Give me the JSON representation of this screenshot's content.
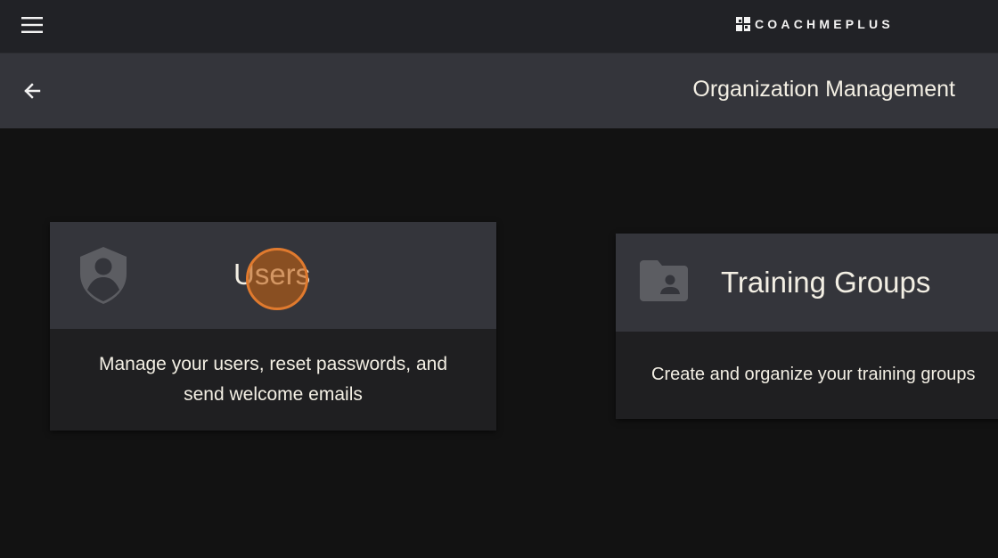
{
  "topbar": {
    "menu_icon": "hamburger-menu-icon",
    "logo_icon": "coachmeplus-logo-icon",
    "logo_text": "COACHMEPLUS"
  },
  "subbar": {
    "back_icon": "arrow-left-icon",
    "title": "Organization Management"
  },
  "cards": [
    {
      "icon": "shield-user-icon",
      "title": "Users",
      "description": "Manage your users, reset passwords, and send welcome emails"
    },
    {
      "icon": "folder-user-icon",
      "title": "Training Groups",
      "description": "Create and organize your training groups"
    }
  ],
  "colors": {
    "topbar_bg": "#212226",
    "subbar_bg": "#34353b",
    "page_bg": "#121212",
    "card_body_bg": "#1f1f21",
    "icon_gray": "#5c5d62",
    "text": "#f3efe4",
    "click_indicator": "#e07a2e"
  }
}
